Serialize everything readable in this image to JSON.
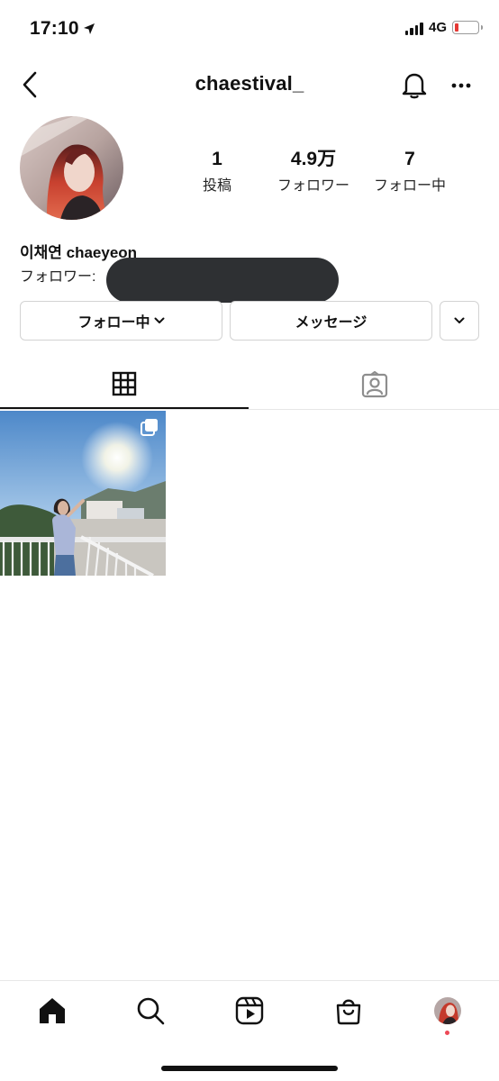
{
  "status_bar": {
    "time": "17:10",
    "network": "4G",
    "battery_level": 0.12
  },
  "header": {
    "username": "chaestival_",
    "back_icon": "chevron-left-icon",
    "bell_icon": "bell-icon",
    "more_icon": "more-horizontal-icon"
  },
  "profile": {
    "stats": [
      {
        "value": "1",
        "label": "投稿"
      },
      {
        "value": "4.9万",
        "label": "フォロワー"
      },
      {
        "value": "7",
        "label": "フォロー中"
      }
    ],
    "display_name": "이채연 chaeyeon",
    "followed_by_label": "フォロワー:"
  },
  "buttons": {
    "follow_label": "フォロー中",
    "message_label": "メッセージ",
    "suggest_icon": "chevron-down-icon"
  },
  "tabs": [
    {
      "name": "grid",
      "icon": "grid-icon",
      "active": true
    },
    {
      "name": "tagged",
      "icon": "tagged-person-icon",
      "active": false
    }
  ],
  "posts": [
    {
      "multiple": true
    }
  ],
  "bottom_nav": [
    {
      "name": "home",
      "icon": "home-icon",
      "active": true
    },
    {
      "name": "search",
      "icon": "search-icon"
    },
    {
      "name": "reels",
      "icon": "reels-icon"
    },
    {
      "name": "shop",
      "icon": "shopping-bag-icon"
    },
    {
      "name": "profile",
      "icon": "profile-avatar"
    }
  ],
  "colors": {
    "accent_red": "#ed4956",
    "redaction": "#2e3033"
  }
}
